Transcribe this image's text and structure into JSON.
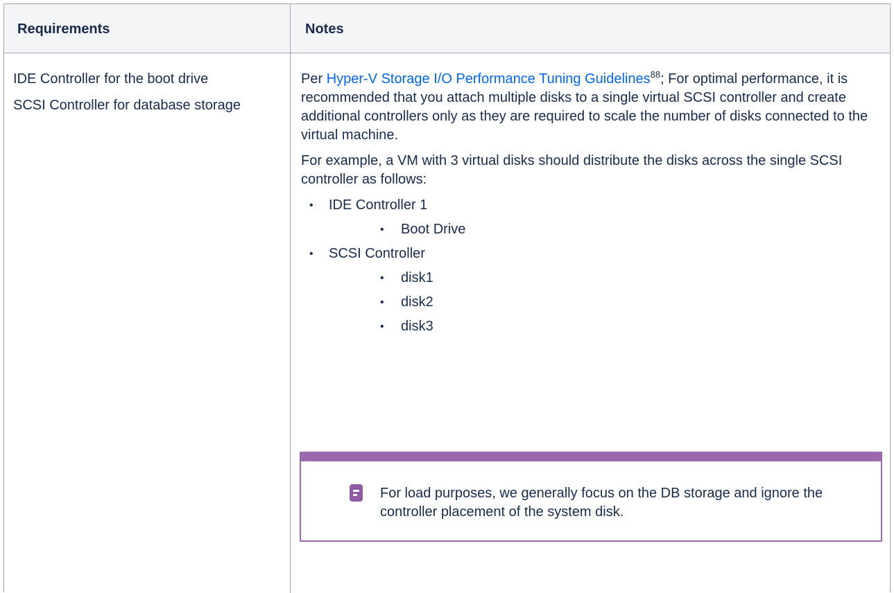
{
  "table": {
    "headers": [
      "Requirements",
      "Notes"
    ]
  },
  "requirements": [
    "IDE Controller for the boot drive",
    "SCSI Controller for database storage"
  ],
  "notes": {
    "intro_prefix": "Per ",
    "link_text": "Hyper-V Storage I/O Performance Tuning Guidelines",
    "footnote": "88",
    "intro_suffix": "; For optimal performance, it is recommended that you attach multiple disks to a single virtual SCSI controller and create additional controllers only as they are required to scale the number of disks connected to the virtual machine.",
    "example": "For example, a VM with 3 virtual disks should distribute the disks across the single SCSI controller as follows:",
    "bullet_glyph": "•",
    "list": [
      {
        "label": "IDE Controller 1",
        "children": [
          "Boot Drive"
        ]
      },
      {
        "label": "SCSI Controller",
        "children": [
          "disk1",
          "disk2",
          "disk3"
        ]
      }
    ]
  },
  "note_panel": {
    "icon": "note-icon",
    "accent_color": "#9b68ab",
    "text": "For load purposes, we generally focus on the DB storage and ignore the controller placement of the system disk."
  }
}
